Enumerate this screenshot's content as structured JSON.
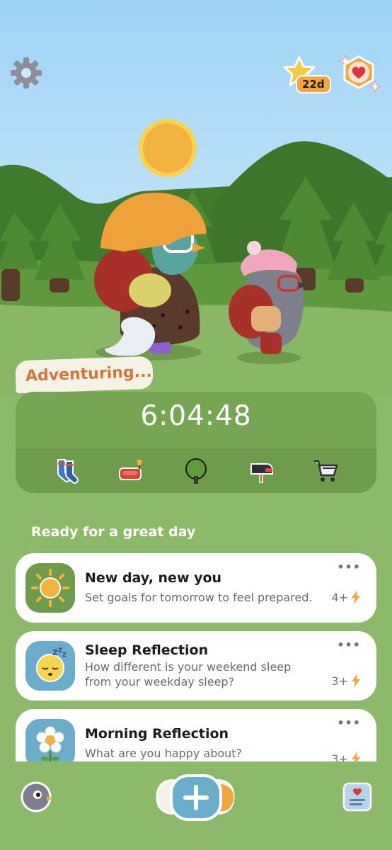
{
  "header": {
    "streak_badge": "22d",
    "settings_icon": "gear-icon",
    "streak_icon": "star-icon",
    "heart_icon": "heart-icon"
  },
  "adventure": {
    "status": "Adventuring...",
    "timer": "6:04:48",
    "icons": [
      "socks-icon",
      "couch-icon",
      "tree-icon",
      "mailbox-icon",
      "shopping-cart-icon"
    ]
  },
  "section_title": "Ready for a great day",
  "tasks": [
    {
      "title": "New day, new you",
      "description": "Set goals for tomorrow to feel prepared.",
      "points": "4+",
      "icon": "sun-icon"
    },
    {
      "title": "Sleep Reflection",
      "description": "How different is your weekend sleep from your weekday sleep?",
      "points": "3+",
      "icon": "sleeping-face-icon"
    },
    {
      "title": "Morning Reflection",
      "description": "What are you happy about?",
      "points": "3+",
      "icon": "flower-icon"
    }
  ],
  "more_label": "•••",
  "bottom_nav": {
    "profile_icon": "bird-avatar-icon",
    "add_icon": "plus-icon",
    "journal_icon": "journal-icon"
  },
  "colors": {
    "sky": "#a9d8f3",
    "grass": "#8dba6a",
    "card_green": "#76a653",
    "accent_orange": "#f3a73b",
    "status_text": "#d0773c"
  }
}
